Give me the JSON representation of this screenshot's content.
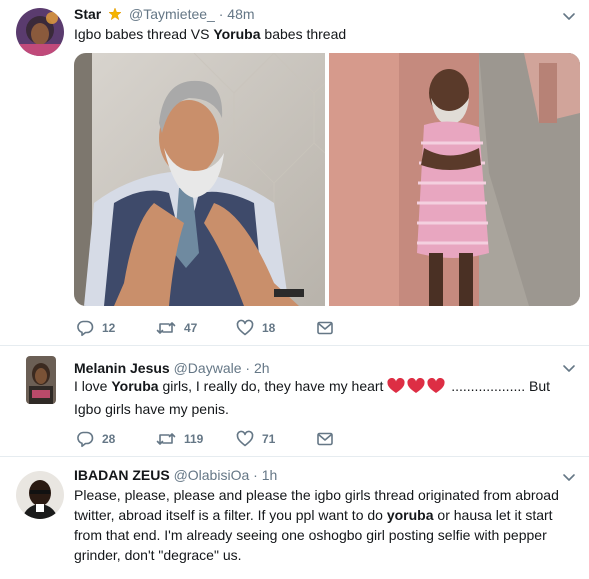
{
  "tweets": [
    {
      "name": "Star",
      "badge": "star-emoji",
      "handle": "@Taymietee_",
      "sep": "·",
      "time": "48m",
      "text_a": "Igbo babes thread VS ",
      "text_bold": "Yoruba",
      "text_b": " babes thread",
      "media": [
        "man-fixing-tie-photo",
        "elderly-man-pink-dress-photo"
      ],
      "reply_count": "12",
      "retweet_count": "47",
      "like_count": "18"
    },
    {
      "name": "Melanin Jesus",
      "handle": "@Daywale",
      "sep": "·",
      "time": "2h",
      "text_a": "I love ",
      "text_bold": "Yoruba",
      "text_b": " girls, I really do, they have my heart ",
      "text_c": " ................... But Igbo girls have my penis.",
      "reply_count": "28",
      "retweet_count": "119",
      "like_count": "71"
    },
    {
      "name": "IBADAN ZEUS",
      "handle": "@OlabisiOa",
      "sep": "·",
      "time": "1h",
      "text_a": "Please, please, please and please the igbo girls thread originated from abroad twitter, abroad itself is a filter. If you ppl want to do ",
      "text_bold": "yoruba",
      "text_b": " or hausa let it start from that end. I'm already seeing one oshogbo girl posting selfie with pepper grinder, don't \"degrace\" us."
    }
  ],
  "colors": {
    "text": "#14171a",
    "meta": "#657786",
    "divider": "#e6ecf0",
    "heart": "#dd2e44"
  },
  "icons": [
    "reply-icon",
    "retweet-icon",
    "like-icon",
    "message-icon",
    "chevron-down-icon"
  ]
}
